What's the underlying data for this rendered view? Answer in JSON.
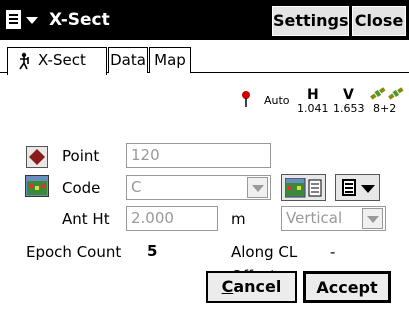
{
  "titlebar": {
    "title": "X-Sect",
    "settings_label": "Settings",
    "close_label": "Close"
  },
  "tabs": [
    {
      "label": "X-Sect",
      "active": true
    },
    {
      "label": "Data",
      "active": false
    },
    {
      "label": "Map",
      "active": false
    }
  ],
  "status": {
    "mode": "Auto",
    "h_label": "H",
    "h_value": "1.041",
    "v_label": "V",
    "v_value": "1.653",
    "sats": "8+2"
  },
  "form": {
    "point_label": "Point",
    "point_value": "120",
    "code_label": "Code",
    "code_value": "C",
    "ant_ht_label": "Ant Ht",
    "ant_ht_value": "2.000",
    "ant_ht_unit": "m",
    "ant_ht_method": "Vertical"
  },
  "info": {
    "epoch_label": "Epoch Count",
    "epoch_value": "5",
    "along_label": "Along CL",
    "along_value": "-",
    "offset_label": "Offset",
    "offset_value": "-"
  },
  "buttons": {
    "cancel_label": "Cancel",
    "accept_label": "Accept"
  },
  "colors": {
    "titlebar_bg": "#000000",
    "point_icon": "#8b1a1a",
    "pin_red": "#cc0000",
    "disabled_text": "#999999"
  }
}
